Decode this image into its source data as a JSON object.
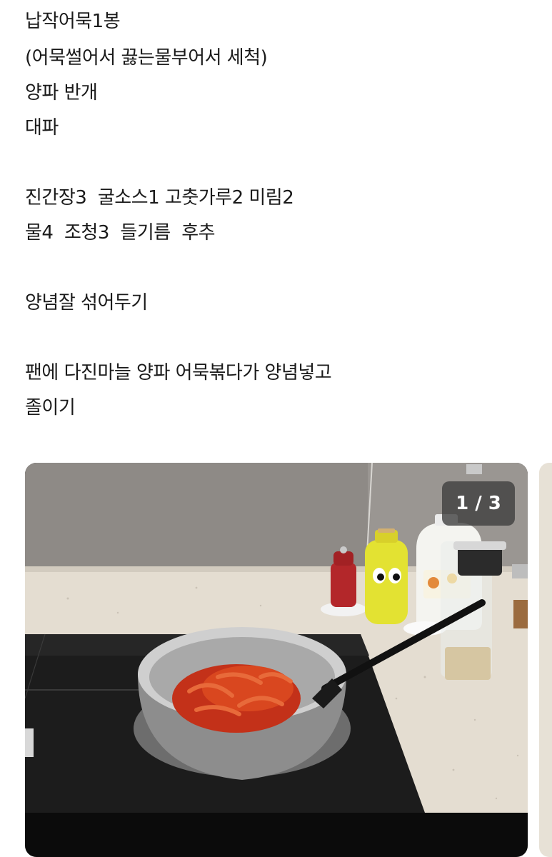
{
  "post": {
    "lines": [
      "납작어묵1봉",
      "(어묵썰어서 끓는물부어서 세척)",
      "양파 반개",
      "대파",
      "",
      "진간장3  굴소스1 고춧가루2 미림2",
      "물4  조청3  들기름  후추",
      "",
      "양념잘 섞어두기",
      "",
      "팬에 다진마늘 양파 어묵볶다가 양념넣고",
      "졸이기"
    ]
  },
  "carousel": {
    "counter": "1 / 3",
    "current_slide": 1,
    "total_slides": 3
  },
  "colors": {
    "text": "#1a1a1a",
    "counter_bg": "#3c3c3c",
    "background": "#ffffff"
  }
}
